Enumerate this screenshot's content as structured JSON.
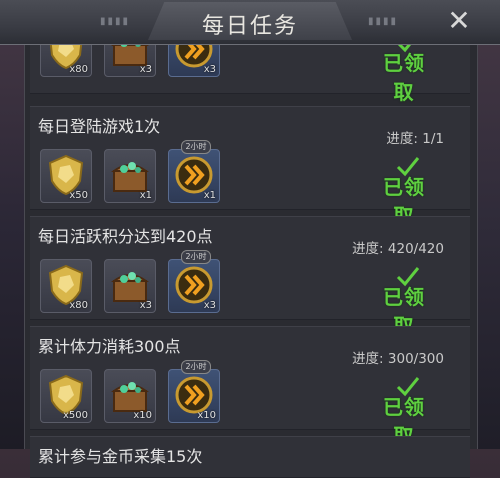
{
  "window": {
    "title": "每日任务"
  },
  "tasks": [
    {
      "name": "",
      "progress": "",
      "rewards": [
        {
          "kind": "gold-shield",
          "qty": "x80"
        },
        {
          "kind": "gem-chest",
          "qty": "x3"
        },
        {
          "kind": "speed-up",
          "qty": "x3",
          "timer": ""
        }
      ],
      "status": "已领取"
    },
    {
      "name": "每日登陆游戏1次",
      "progress": "进度: 1/1",
      "rewards": [
        {
          "kind": "gold-shield",
          "qty": "x50"
        },
        {
          "kind": "gem-chest",
          "qty": "x1"
        },
        {
          "kind": "speed-up",
          "qty": "x1",
          "timer": "2小时"
        }
      ],
      "status": "已领取"
    },
    {
      "name": "每日活跃积分达到420点",
      "progress": "进度: 420/420",
      "rewards": [
        {
          "kind": "gold-shield",
          "qty": "x80"
        },
        {
          "kind": "gem-chest",
          "qty": "x3"
        },
        {
          "kind": "speed-up",
          "qty": "x3",
          "timer": "2小时"
        }
      ],
      "status": "已领取"
    },
    {
      "name": "累计体力消耗300点",
      "progress": "进度: 300/300",
      "rewards": [
        {
          "kind": "gold-shield",
          "qty": "x500"
        },
        {
          "kind": "gem-chest",
          "qty": "x10"
        },
        {
          "kind": "speed-up",
          "qty": "x10",
          "timer": "2小时"
        }
      ],
      "status": "已领取"
    },
    {
      "name": "累计参与金币采集15次",
      "progress": "",
      "rewards": [],
      "status": ""
    }
  ],
  "colors": {
    "claimed": "#5fd040",
    "panel": "#2a2b31",
    "row": "#303138"
  }
}
